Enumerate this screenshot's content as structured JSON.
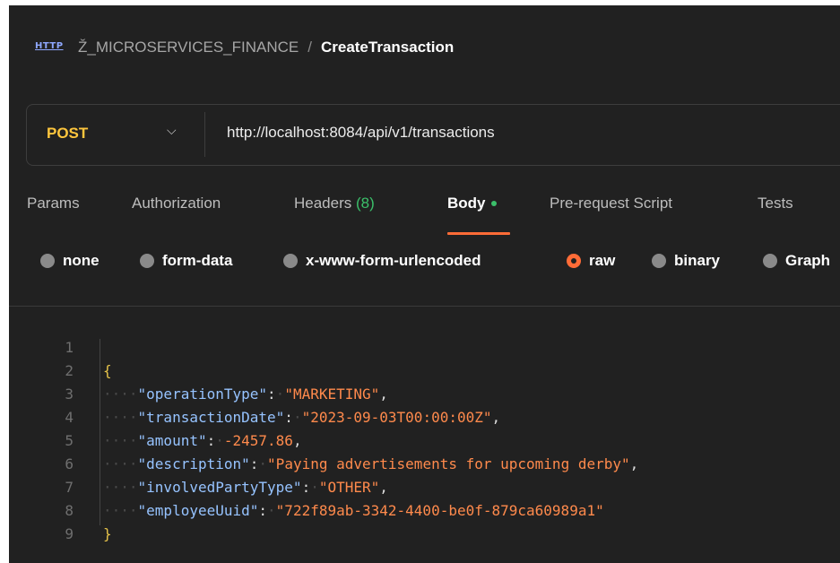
{
  "header": {
    "http_icon_label": "HTTP",
    "collection": "Ž_MICROSERVICES_FINANCE",
    "separator": "/",
    "request_name": "CreateTransaction"
  },
  "request": {
    "method": "POST",
    "url": "http://localhost:8084/api/v1/transactions"
  },
  "tabs": [
    {
      "label": "Params"
    },
    {
      "label": "Authorization"
    },
    {
      "label": "Headers",
      "count": "(8)"
    },
    {
      "label": "Body"
    },
    {
      "label": "Pre-request Script"
    },
    {
      "label": "Tests"
    }
  ],
  "body_types": [
    {
      "label": "none"
    },
    {
      "label": "form-data"
    },
    {
      "label": "x-www-form-urlencoded"
    },
    {
      "label": "raw"
    },
    {
      "label": "binary"
    },
    {
      "label": "Graph"
    }
  ],
  "editor": {
    "line_numbers": [
      "1",
      "2",
      "3",
      "4",
      "5",
      "6",
      "7",
      "8",
      "9"
    ],
    "open_brace": "{",
    "close_brace": "}",
    "fields": [
      {
        "key": "\"operationType\"",
        "value": "\"MARKETING\"",
        "value_type": "string"
      },
      {
        "key": "\"transactionDate\"",
        "value": "\"2023-09-03T00:00:00Z\"",
        "value_type": "string"
      },
      {
        "key": "\"amount\"",
        "value": "-2457.86",
        "value_type": "number"
      },
      {
        "key": "\"description\"",
        "value": "\"Paying advertisements for upcoming derby\"",
        "value_type": "string"
      },
      {
        "key": "\"involvedPartyType\"",
        "value": "\"OTHER\"",
        "value_type": "string"
      },
      {
        "key": "\"employeeUuid\"",
        "value": "\"722f89ab-3342-4400-be0f-879ca60989a1\"",
        "value_type": "string"
      }
    ]
  },
  "colors": {
    "background": "#212121",
    "accent": "#ff6c37",
    "method": "#ffc63d",
    "count_green": "#3bbf6a",
    "json_key": "#96c3ff",
    "json_value": "#ff8a4c"
  }
}
